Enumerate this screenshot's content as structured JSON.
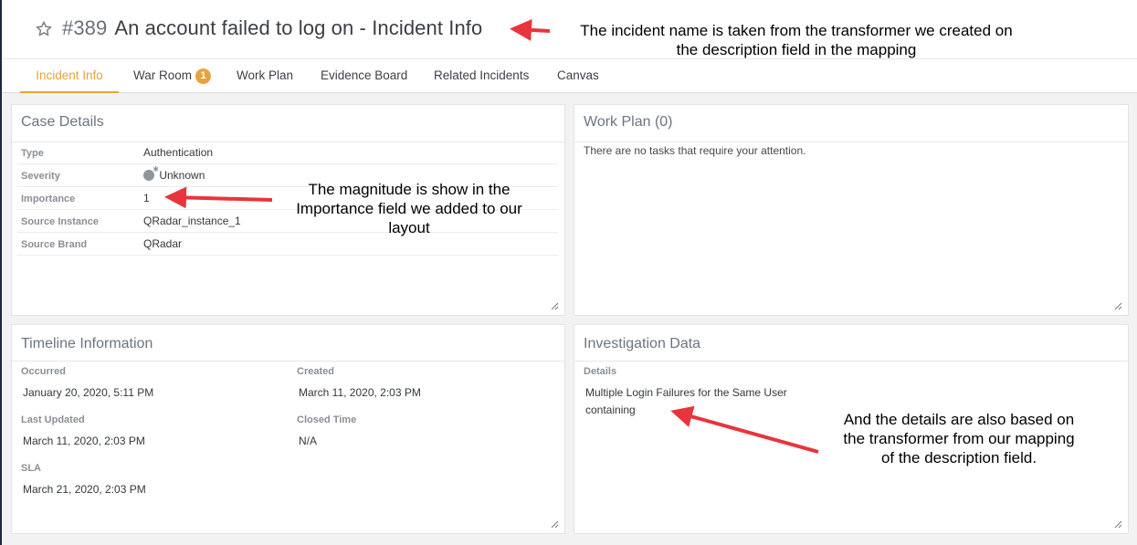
{
  "header": {
    "incident_number": "#389",
    "incident_name": "An account failed to log on - Incident Info"
  },
  "tabs": [
    {
      "label": "Incident Info",
      "active": true
    },
    {
      "label": "War Room",
      "badge": "1"
    },
    {
      "label": "Work Plan"
    },
    {
      "label": "Evidence Board"
    },
    {
      "label": "Related Incidents"
    },
    {
      "label": "Canvas"
    }
  ],
  "case_details": {
    "title": "Case Details",
    "rows": [
      {
        "key": "Type",
        "value": "Authentication"
      },
      {
        "key": "Severity",
        "value": "Unknown"
      },
      {
        "key": "Importance",
        "value": "1"
      },
      {
        "key": "Source Instance",
        "value": "QRadar_instance_1"
      },
      {
        "key": "Source Brand",
        "value": "QRadar"
      }
    ]
  },
  "work_plan": {
    "title": "Work Plan (0)",
    "empty_message": "There are no tasks that require your attention."
  },
  "timeline": {
    "title": "Timeline Information",
    "occurred_label": "Occurred",
    "occurred_value": "January 20, 2020, 5:11 PM",
    "created_label": "Created",
    "created_value": "March 11, 2020, 2:03 PM",
    "last_updated_label": "Last Updated",
    "last_updated_value": "March 11, 2020, 2:03 PM",
    "closed_time_label": "Closed Time",
    "closed_time_value": "N/A",
    "sla_label": "SLA",
    "sla_value": "March 21, 2020, 2:03 PM"
  },
  "investigation": {
    "title": "Investigation Data",
    "details_label": "Details",
    "details_value": "Multiple Login Failures for the Same User containing"
  },
  "annotations": {
    "title_note_line1": "The incident name is taken from the transformer we created on",
    "title_note_line2": "the description field in the mapping",
    "importance_note": "The magnitude is show in the Importance field we added to our layout",
    "details_note": "And the details are also based on the transformer from our mapping of the description field."
  },
  "colors": {
    "accent": "#e8a33c",
    "arrow": "#e8343c"
  }
}
